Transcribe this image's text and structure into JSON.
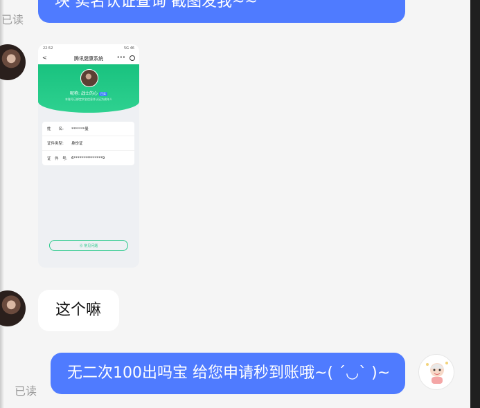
{
  "messages": {
    "top_outgoing": "块 实名认证查询 截图发我~~",
    "top_read": "已读",
    "incoming_text": "这个嘛",
    "bottom_outgoing": "无二次100出吗宝 给您申请秒到账哦~( ´◡` )~",
    "bottom_read": "已读"
  },
  "screenshot": {
    "status_time": "22:52",
    "status_icons": "5G 46",
    "back_glyph": "<",
    "title": "腾讯健康系统",
    "more_glyph": "•••",
    "nickname": "昵称: 战士的心",
    "tag": "已实",
    "note": "本账号已绑定实名信息并认证为成年人",
    "fields": [
      {
        "label": "姓　　名:",
        "value": "*******曼"
      },
      {
        "label": "证件类型:",
        "value": "身份证"
      },
      {
        "label": "证　件　号:",
        "value": "6***************9"
      }
    ],
    "faq_label": "⓪ 常见问题"
  },
  "colors": {
    "outgoing_bubble": "#4f7bff",
    "incoming_bubble": "#ffffff",
    "hero_green": "#19c27f",
    "background": "#f5f5f5"
  }
}
